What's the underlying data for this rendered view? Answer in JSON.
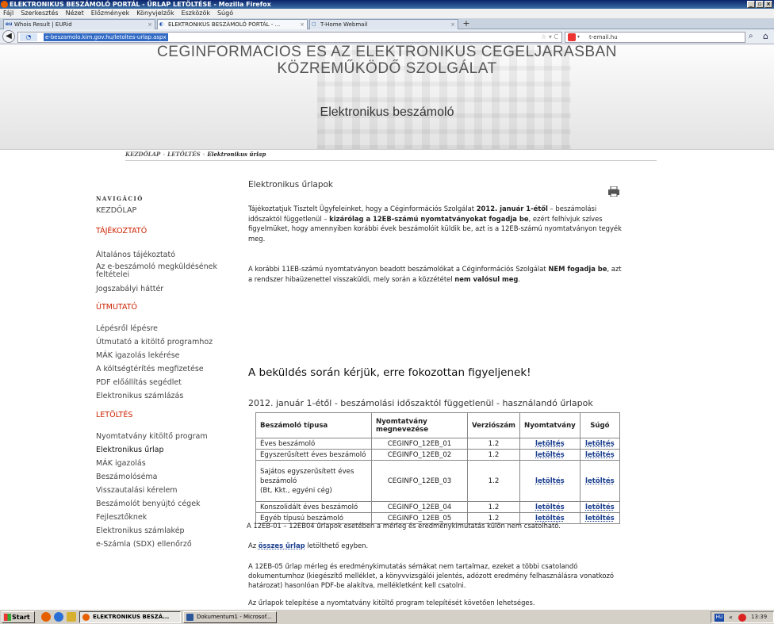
{
  "browser": {
    "window_title": "ELEKTRONIKUS BESZÁMOLÓ PORTÁL - ŰRLAP LETÖLTÉSE - Mozilla Firefox",
    "menu": [
      "Fájl",
      "Szerkesztés",
      "Nézet",
      "Előzmények",
      "Könyvjelzők",
      "Eszközök",
      "Súgó"
    ],
    "tabs": [
      {
        "label": "Whois Result | EURid",
        "icon": "eu"
      },
      {
        "label": "ELEKTRONIKUS BESZÁMOLÓ PORTÁL - ...",
        "icon": "page"
      },
      {
        "label": "T-Home Webmail",
        "icon": "page"
      }
    ],
    "url": "e-beszamolo.kim.gov.hu/letoltes-urlap.aspx",
    "search_engine": "t-email.hu"
  },
  "banner": {
    "line1": "CÉGINFORMÁCIÓS ÉS AZ ELEKTRONIKUS CÉGELJÁRÁSBAN",
    "line2": "KÖZREMŰKÖDŐ SZOLGÁLAT",
    "subtitle": "Elektronikus beszámoló"
  },
  "breadcrumb": {
    "home": "KEZDŐLAP",
    "download": "LETÖLTÉS",
    "current": "Elektronikus űrlap"
  },
  "sidebar": {
    "heading": "NAVIGÁCIÓ",
    "home": "KEZDŐLAP",
    "info_title": "TÁJÉKOZTATÓ",
    "info_items": [
      "Általános tájékoztató",
      "Az e-beszámoló megküldésének feltételei",
      "Jogszabályi háttér"
    ],
    "guide_title": "ÚTMUTATÓ",
    "guide_items": [
      "Lépésről lépésre",
      "Útmutató a kitöltő programhoz",
      "MÁK igazolás lekérése",
      "A költségtérítés megfizetése",
      "PDF előállítás segédlet",
      "Elektronikus számlázás"
    ],
    "download_title": "LETÖLTÉS",
    "download_items": [
      "Nyomtatvány kitöltő program",
      "Elektronikus űrlap",
      "MÁK igazolás",
      "Beszámolóséma",
      "Visszautalási kérelem",
      "Beszámolót benyújtó cégek",
      "Fejlesztőknek",
      "Elektronikus számlakép",
      "e-Számla (SDX) ellenőrző"
    ]
  },
  "main": {
    "title": "Elektronikus űrlapok",
    "p1_a": "Tájékoztatjuk Tisztelt Ügyfeleinket, hogy a Céginformációs Szolgálat ",
    "p1_b": "2012. január 1-étől",
    "p1_c": " – beszámolási időszaktól függetlenül – ",
    "p1_d": "kizárólag a 12EB-számú nyomtatványokat fogadja be",
    "p1_e": ", ezért felhívjuk szíves figyelmüket, hogy amennyiben korábbi évek beszámolóit küldik be, azt is a 12EB-számú nyomtatványon tegyék meg.",
    "p2_a": "A korábbi 11EB-számú nyomtatványon beadott beszámolókat a Céginformációs Szolgálat ",
    "p2_b": "NEM fogadja be",
    "p2_c": ", azt a rendszer hibaüzenettel visszaküldi, mely során a közzététel ",
    "p2_d": "nem valósul meg",
    "p2_e": ".",
    "warning": "A beküldés során kérjük, erre fokozottan figyeljenek!",
    "table_title": "2012. január 1-étől - beszámolási időszaktól függetlenül - használandó űrlapok",
    "table": {
      "headers": [
        "Beszámoló típusa",
        "Nyomtatvány megnevezése",
        "Verziószám",
        "Nyomtatvány",
        "Súgó"
      ],
      "rows": [
        {
          "type": "Éves beszámoló",
          "form": "CEGINFO_12EB_01",
          "version": "1.2",
          "dl": "letöltés",
          "help": "letöltés"
        },
        {
          "type": "Egyszerűsített éves beszámoló",
          "form": "CEGINFO_12EB_02",
          "version": "1.2",
          "dl": "letöltés",
          "help": "letöltés"
        },
        {
          "type": "Sajátos egyszerűsített éves beszámoló",
          "type_note": "(Bt, Kkt., egyéni cég)",
          "form": "CEGINFO_12EB_03",
          "version": "1.2",
          "dl": "letöltés",
          "help": "letöltés"
        },
        {
          "type": "Konszolidált éves beszámoló",
          "form": "CEGINFO_12EB_04",
          "version": "1.2",
          "dl": "letöltés",
          "help": "letöltés"
        },
        {
          "type": "Egyéb típusú beszámoló",
          "form": "CEGINFO_12EB_05",
          "version": "1.2",
          "dl": "letöltés",
          "help": "letöltés"
        }
      ]
    },
    "note1": "A 12EB-01 – 12EB04 űrlapok esetében a mérleg és eredménykimutatás külön nem csatolható.",
    "note2_a": "Az ",
    "note2_link": "összes űrlap",
    "note2_b": " letölthető egyben.",
    "note3": "A 12EB-05 űrlap mérleg és eredménykimutatás sémákat nem tartalmaz, ezeket a többi csatolandó dokumentumhoz (kiegészítő melléklet, a könyvvizsgálói jelentés, adózott eredmény felhasználásra vonatkozó határozat) hasonlóan PDF-be alakítva, mellékletként kell csatolni.",
    "note4": "Az űrlapok telepítése a nyomtatvány kitöltő program telepítését követően lehetséges."
  },
  "taskbar": {
    "start": "Start",
    "items": [
      "ELEKTRONIKUS BESZÁ...",
      "Dokumentum1 - Microsof..."
    ],
    "lang": "HU",
    "clock": "13:39"
  }
}
